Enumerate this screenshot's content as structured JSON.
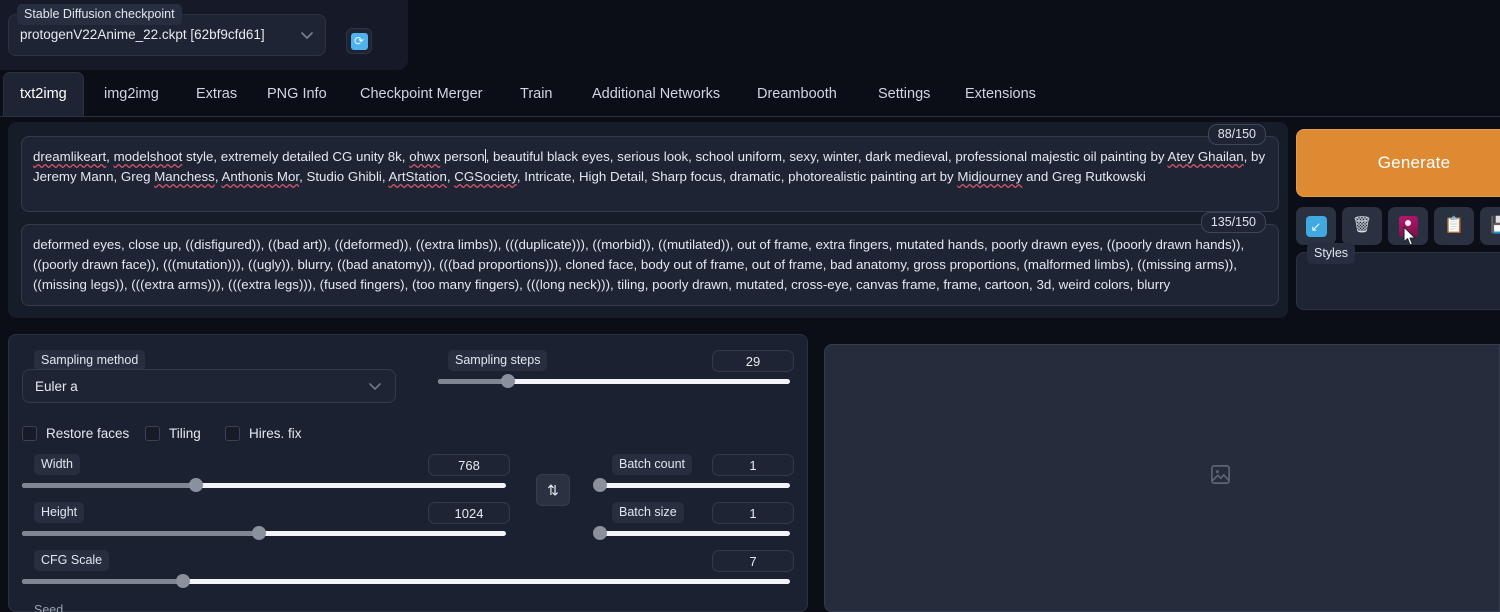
{
  "checkpoint": {
    "label": "Stable Diffusion checkpoint",
    "value": "protogenV22Anime_22.ckpt [62bf9cfd61]",
    "refresh_icon": "refresh-icon",
    "caret_icon": "chevron-down-icon"
  },
  "tabs": [
    {
      "label": "txt2img",
      "active": true
    },
    {
      "label": "img2img",
      "active": false
    },
    {
      "label": "Extras",
      "active": false
    },
    {
      "label": "PNG Info",
      "active": false
    },
    {
      "label": "Checkpoint Merger",
      "active": false
    },
    {
      "label": "Train",
      "active": false
    },
    {
      "label": "Additional Networks",
      "active": false
    },
    {
      "label": "Dreambooth",
      "active": false
    },
    {
      "label": "Settings",
      "active": false
    },
    {
      "label": "Extensions",
      "active": false
    }
  ],
  "prompt": {
    "tokens": "88/150",
    "segments": [
      {
        "t": "dreamlikeart",
        "sq": true
      },
      {
        "t": ", "
      },
      {
        "t": "modelshoot",
        "sq": true
      },
      {
        "t": " style, extremely detailed CG unity 8k, "
      },
      {
        "t": "ohwx",
        "sq": true
      },
      {
        "t": " person"
      },
      {
        "t": "|",
        "caret": true
      },
      {
        "t": ", beautiful black eyes, serious look, school uniform, sexy, winter, dark medieval, professional majestic oil painting by "
      },
      {
        "t": "Atey Ghailan",
        "sq": true
      },
      {
        "t": ", by Jeremy Mann, Greg "
      },
      {
        "t": "Manchess",
        "sq": true
      },
      {
        "t": ", "
      },
      {
        "t": "Anthonis Mor",
        "sq": true
      },
      {
        "t": ", Studio Ghibli, "
      },
      {
        "t": "ArtStation",
        "sq": true
      },
      {
        "t": ", "
      },
      {
        "t": "CGSociety",
        "sq": true
      },
      {
        "t": ", Intricate, High Detail, Sharp focus, dramatic, photorealistic painting art by "
      },
      {
        "t": "Midjourney",
        "sq": true
      },
      {
        "t": " and Greg Rutkowski"
      }
    ]
  },
  "negative_prompt": {
    "tokens": "135/150",
    "text": "deformed eyes, close up, ((disfigured)), ((bad art)), ((deformed)), ((extra limbs)), (((duplicate))), ((morbid)), ((mutilated)), out of frame, extra fingers, mutated hands, poorly drawn eyes, ((poorly drawn hands)), ((poorly drawn face)), (((mutation))), ((ugly)), blurry, ((bad anatomy)), (((bad proportions))), cloned face, body out of frame, out of frame, bad anatomy, gross proportions, (malformed limbs), ((missing arms)), ((missing legs)), (((extra arms))), (((extra legs))), (fused fingers), (too many fingers), (((long neck))), tiling, poorly drawn, mutated, cross-eye, canvas frame, frame, cartoon, 3d, weird colors, blurry"
  },
  "actions": {
    "generate_label": "Generate",
    "tools": [
      {
        "name": "restore-progress-icon",
        "glyph": "↙",
        "kind": "arrow"
      },
      {
        "name": "clear-prompt-trash-icon",
        "glyph": "🗑",
        "kind": "trash"
      },
      {
        "name": "show-extra-networks-icon",
        "glyph": "🎴",
        "kind": "cards"
      },
      {
        "name": "read-generation-parameters-icon",
        "glyph": "📋",
        "kind": "clipboard"
      },
      {
        "name": "apply-style-icon",
        "glyph": "💾",
        "kind": "save"
      }
    ],
    "styles_label": "Styles"
  },
  "settings": {
    "sampling_method": {
      "label": "Sampling method",
      "value": "Euler a"
    },
    "sampling_steps": {
      "label": "Sampling steps",
      "value": "29",
      "pct": 20
    },
    "checkboxes": [
      {
        "label": "Restore faces",
        "checked": false
      },
      {
        "label": "Tiling",
        "checked": false
      },
      {
        "label": "Hires. fix",
        "checked": false
      }
    ],
    "width": {
      "label": "Width",
      "value": "768",
      "pct": 36
    },
    "height": {
      "label": "Height",
      "value": "1024",
      "pct": 49
    },
    "batch_count": {
      "label": "Batch count",
      "value": "1",
      "pct": 0
    },
    "batch_size": {
      "label": "Batch size",
      "value": "1",
      "pct": 0
    },
    "cfg_scale": {
      "label": "CFG Scale",
      "value": "7",
      "pct": 21
    },
    "swap_icon": "swap-dimensions-icon",
    "seed_label": "Seed"
  },
  "output": {
    "placeholder_icon": "image-placeholder-icon"
  },
  "colors": {
    "accent_orange": "#dd8a33",
    "page_bg": "#0b0d17",
    "panel_bg": "#1e2433",
    "spell_underline": "#d0556b"
  }
}
